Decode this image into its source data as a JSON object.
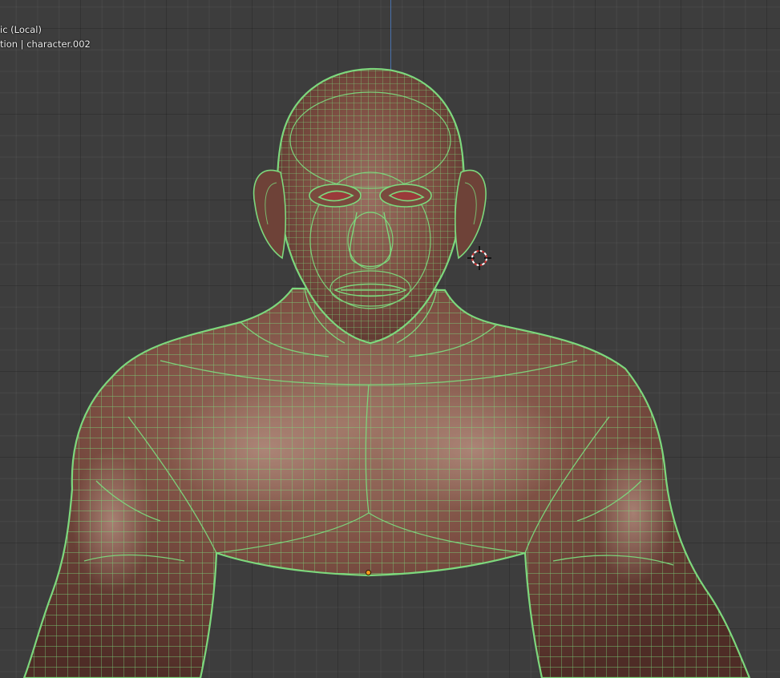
{
  "viewport": {
    "view_name": "ic (Local)",
    "collection_info": "tion | character.002"
  },
  "colors": {
    "background": "#3d3d3d",
    "wire": "#7dd87d",
    "skin": "#7a4a3e",
    "eyes": "#9a3a3a",
    "origin": "#ff9a1a",
    "z_axis": "#4a78b8"
  },
  "icons": {
    "cursor": "3d-cursor-icon",
    "origin": "object-origin-icon"
  }
}
